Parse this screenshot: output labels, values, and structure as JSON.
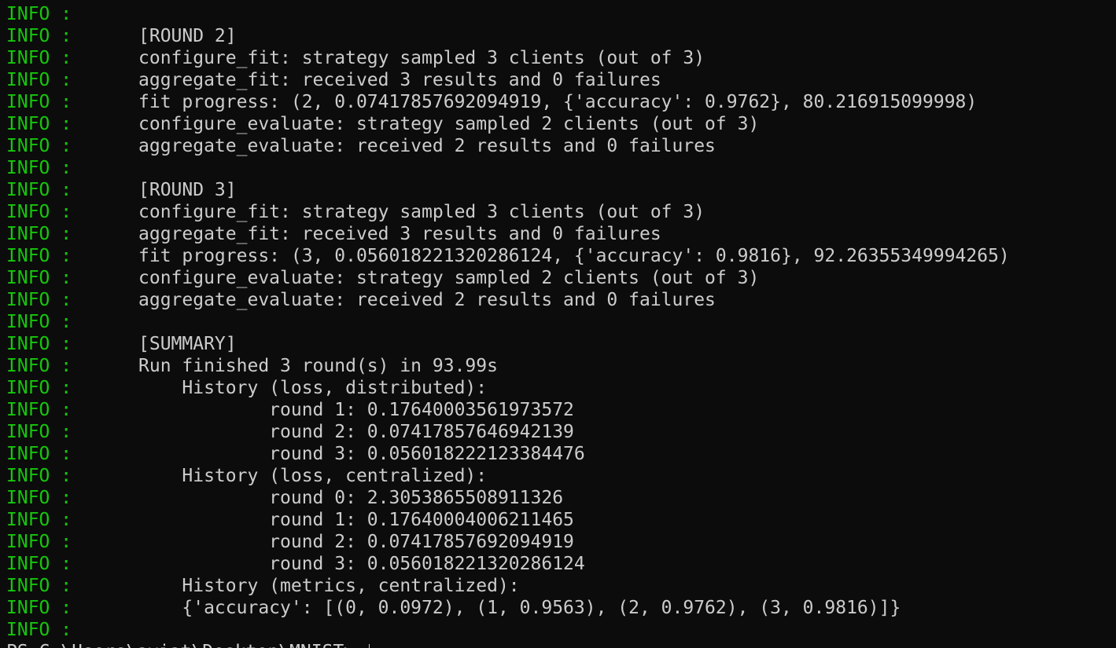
{
  "terminal": {
    "prefix_color": "#16c60c",
    "text_color": "#cccccc",
    "background": "#0c0c0c",
    "lines": [
      {
        "prefix": "INFO :",
        "text": ""
      },
      {
        "prefix": "INFO :",
        "text": "[ROUND 2]"
      },
      {
        "prefix": "INFO :",
        "text": "configure_fit: strategy sampled 3 clients (out of 3)"
      },
      {
        "prefix": "INFO :",
        "text": "aggregate_fit: received 3 results and 0 failures"
      },
      {
        "prefix": "INFO :",
        "text": "fit progress: (2, 0.07417857692094919, {'accuracy': 0.9762}, 80.216915099998)"
      },
      {
        "prefix": "INFO :",
        "text": "configure_evaluate: strategy sampled 2 clients (out of 3)"
      },
      {
        "prefix": "INFO :",
        "text": "aggregate_evaluate: received 2 results and 0 failures"
      },
      {
        "prefix": "INFO :",
        "text": ""
      },
      {
        "prefix": "INFO :",
        "text": "[ROUND 3]"
      },
      {
        "prefix": "INFO :",
        "text": "configure_fit: strategy sampled 3 clients (out of 3)"
      },
      {
        "prefix": "INFO :",
        "text": "aggregate_fit: received 3 results and 0 failures"
      },
      {
        "prefix": "INFO :",
        "text": "fit progress: (3, 0.05601822132028612​4, {'accuracy': 0.9816}, 92.26355349994265)"
      },
      {
        "prefix": "INFO :",
        "text": "configure_evaluate: strategy sampled 2 clients (out of 3)"
      },
      {
        "prefix": "INFO :",
        "text": "aggregate_evaluate: received 2 results and 0 failures"
      },
      {
        "prefix": "INFO :",
        "text": ""
      },
      {
        "prefix": "INFO :",
        "text": "[SUMMARY]"
      },
      {
        "prefix": "INFO :",
        "text": "Run finished 3 round(s) in 93.99s"
      },
      {
        "prefix": "INFO :",
        "text": "    History (loss, distributed):"
      },
      {
        "prefix": "INFO :",
        "text": "            round 1: 0.17640003561973572"
      },
      {
        "prefix": "INFO :",
        "text": "            round 2: 0.07417857646942139"
      },
      {
        "prefix": "INFO :",
        "text": "            round 3: 0.056018222123384476"
      },
      {
        "prefix": "INFO :",
        "text": "    History (loss, centralized):"
      },
      {
        "prefix": "INFO :",
        "text": "            round 0: 2.3053865508911326"
      },
      {
        "prefix": "INFO :",
        "text": "            round 1: 0.17640004006211465"
      },
      {
        "prefix": "INFO :",
        "text": "            round 2: 0.07417857692094919"
      },
      {
        "prefix": "INFO :",
        "text": "            round 3: 0.05601822132028612​4"
      },
      {
        "prefix": "INFO :",
        "text": "    History (metrics, centralized):"
      },
      {
        "prefix": "INFO :",
        "text": "    {'accuracy': [(0, 0.0972), (1, 0.9563), (2, 0.9762), (3, 0.9816)]}"
      },
      {
        "prefix": "INFO :",
        "text": ""
      }
    ],
    "prompt": "PS C:\\Users\\aviat\\Desktop\\MNIST> "
  }
}
